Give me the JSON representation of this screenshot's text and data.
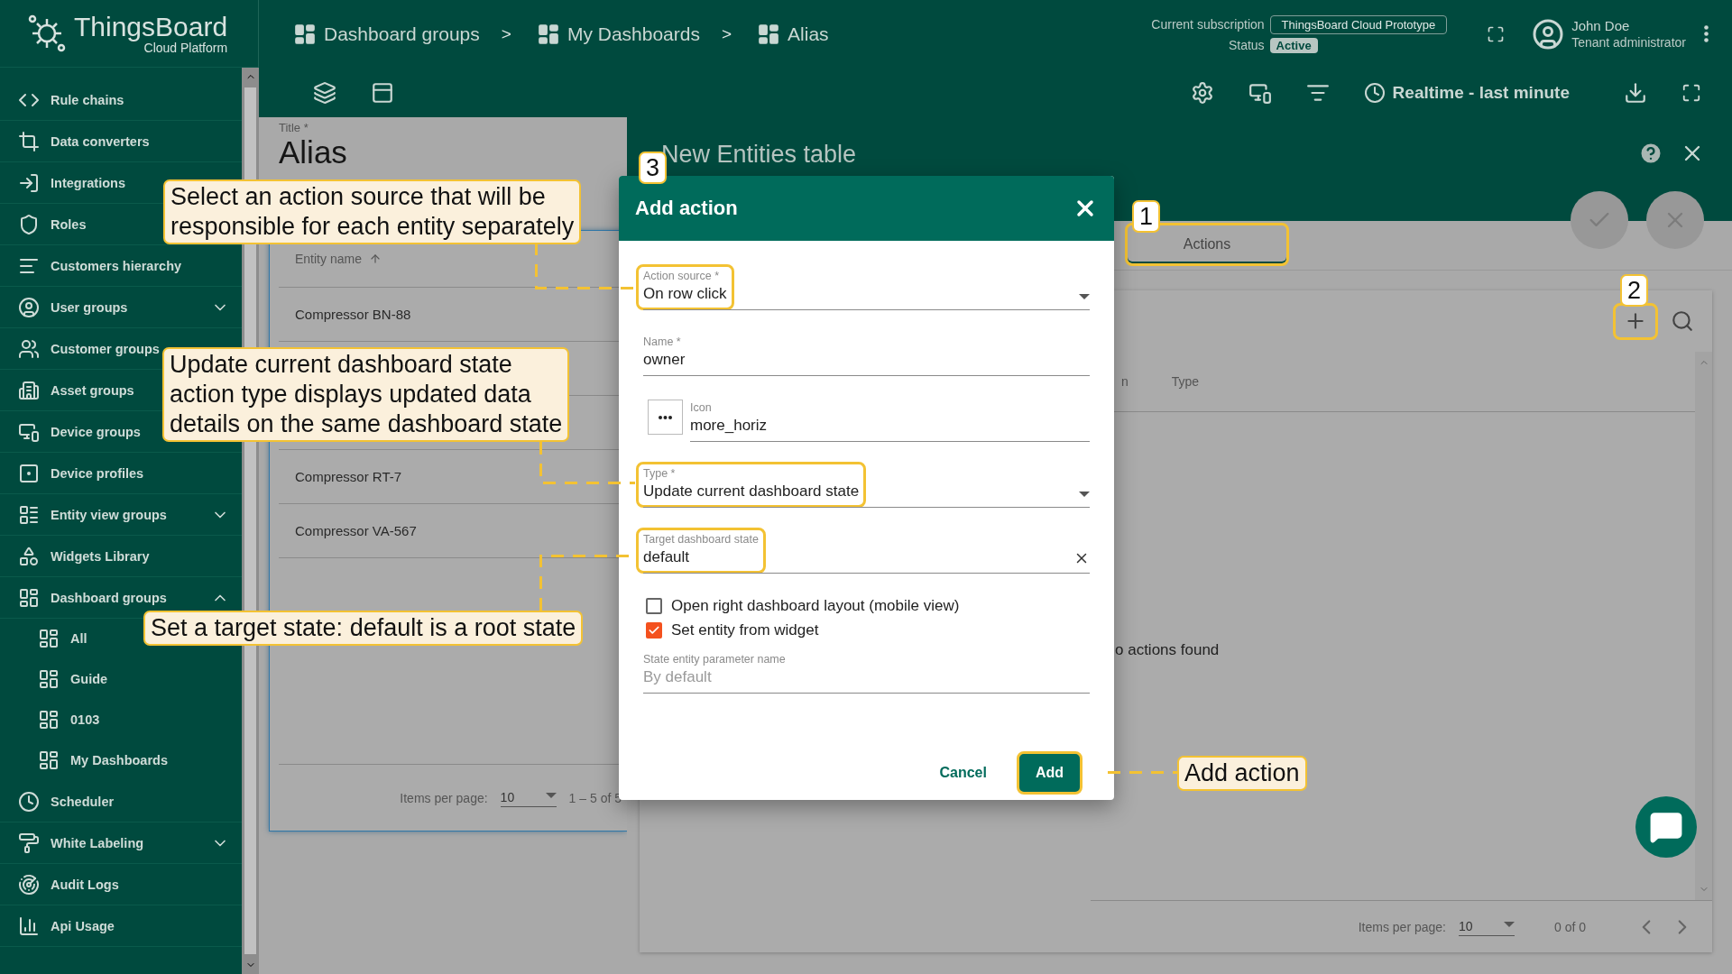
{
  "header": {
    "logo_name": "ThingsBoard",
    "logo_subtitle": "Cloud Platform",
    "breadcrumbs": [
      {
        "label": "Dashboard groups"
      },
      {
        "separator": ">",
        "label": "My Dashboards"
      },
      {
        "separator": ">",
        "label": "Alias"
      }
    ],
    "subscription_label": "Current subscription",
    "subscription": "ThingsBoard Cloud Prototype",
    "status_label": "Status",
    "status": "Active",
    "user_name": "John Doe",
    "user_role": "Tenant administrator"
  },
  "toolbar": {
    "timewindow": "Realtime - last minute"
  },
  "sidebar": {
    "items": [
      {
        "label": "Rule chains"
      },
      {
        "label": "Data converters"
      },
      {
        "label": "Integrations"
      },
      {
        "label": "Roles"
      },
      {
        "label": "Customers hierarchy"
      },
      {
        "label": "User groups",
        "expanded": false
      },
      {
        "label": "Customer groups"
      },
      {
        "label": "Asset groups"
      },
      {
        "label": "Device groups"
      },
      {
        "label": "Device profiles"
      },
      {
        "label": "Entity view groups",
        "expanded": false
      },
      {
        "label": "Widgets Library"
      },
      {
        "label": "Dashboard groups",
        "expanded": true,
        "children": [
          {
            "label": "All"
          },
          {
            "label": "Guide"
          },
          {
            "label": "0103"
          },
          {
            "label": "My Dashboards"
          }
        ]
      },
      {
        "label": "Scheduler"
      },
      {
        "label": "White Labeling",
        "expanded": false
      },
      {
        "label": "Audit Logs"
      },
      {
        "label": "Api Usage"
      }
    ]
  },
  "widget_editor": {
    "title_label": "Title *",
    "title": "Alias",
    "column": "Entity name",
    "rows": [
      "Compressor BN-88",
      "Compressor RT-7",
      "Compressor VA-567"
    ],
    "items_per_page_label": "Items per page:",
    "page_size": "10",
    "range": "1 – 5 of 5"
  },
  "widget_config": {
    "title": "New Entities table",
    "tabs": [
      {
        "label": "Actions",
        "selected": true,
        "highlighted": true
      }
    ],
    "add_highlighted": true,
    "columns": [
      "n",
      "Type"
    ],
    "empty_text": "o actions found",
    "items_per_page_label": "Items per page:",
    "page_size": "10",
    "range": "0 of 0"
  },
  "dialog": {
    "title": "Add action",
    "fields": [
      {
        "kind": "select",
        "label": "Action source *",
        "value": "On row click",
        "highlighted": true
      },
      {
        "kind": "text",
        "label": "Name *",
        "value": "owner",
        "highlighted": false
      },
      {
        "kind": "icon",
        "label": "Icon",
        "value": "more_horiz",
        "highlighted": false
      },
      {
        "kind": "select",
        "label": "Type *",
        "value": "Update current dashboard state",
        "highlighted": true
      },
      {
        "kind": "clearable",
        "label": "Target dashboard state",
        "value": "default",
        "highlighted": true
      }
    ],
    "checkboxes": [
      {
        "label": "Open right dashboard layout (mobile view)",
        "checked": false
      },
      {
        "label": "Set entity from widget",
        "checked": true
      }
    ],
    "param": {
      "label": "State entity parameter name",
      "placeholder": "By default"
    },
    "buttons": [
      {
        "kind": "text",
        "label": "Cancel",
        "highlighted": false
      },
      {
        "kind": "primary",
        "label": "Add",
        "highlighted": true
      }
    ]
  },
  "callouts": [
    {
      "text": "Select an action source that will be\nresponsible for each entity separately"
    },
    {
      "text": "Update current dashboard state\naction type displays updated data\ndetails on the same dashboard state"
    },
    {
      "text": "Set a target state: default is a root state"
    },
    {
      "text": "Add action"
    }
  ],
  "step_badges": [
    {
      "label": "1"
    },
    {
      "label": "2"
    },
    {
      "label": "3"
    }
  ]
}
